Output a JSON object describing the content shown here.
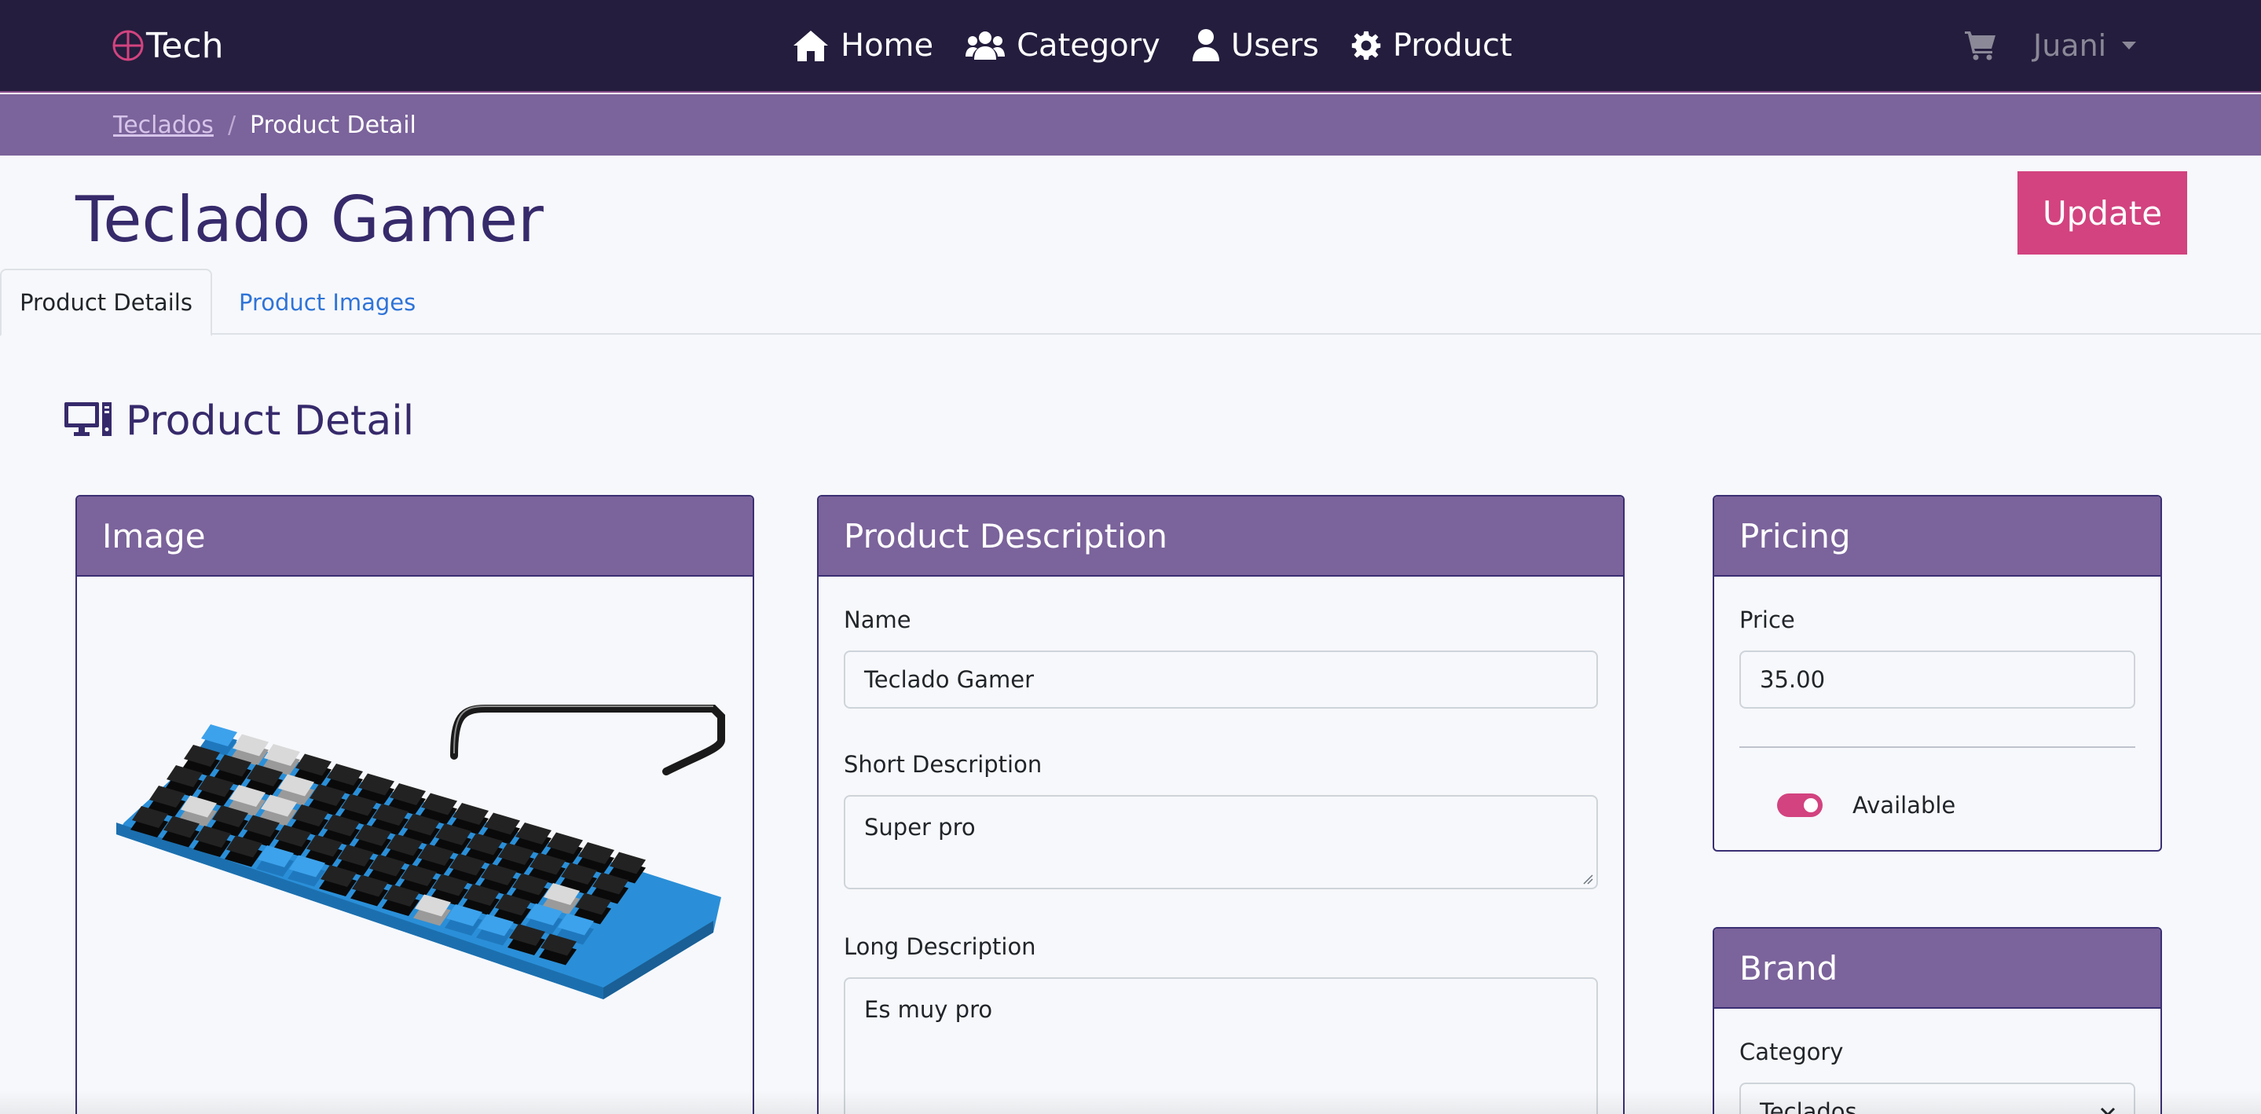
{
  "navbar": {
    "brand": "Tech",
    "links": [
      {
        "label": "Home",
        "icon": "home-icon"
      },
      {
        "label": "Category",
        "icon": "users-icon"
      },
      {
        "label": "Users",
        "icon": "user-icon"
      },
      {
        "label": "Product",
        "icon": "gear-icon"
      }
    ],
    "user": "Juani"
  },
  "breadcrumb": {
    "parent": "Teclados",
    "separator": "/",
    "current": "Product Detail"
  },
  "page": {
    "title": "Teclado Gamer",
    "update_label": "Update"
  },
  "tabs": {
    "details": "Product Details",
    "images": "Product Images"
  },
  "section": {
    "heading": "Product Detail"
  },
  "image_card": {
    "title": "Image"
  },
  "description_card": {
    "title": "Product Description",
    "name_label": "Name",
    "name_value": "Teclado Gamer",
    "short_label": "Short Description",
    "short_value": "Super pro",
    "long_label": "Long Description",
    "long_value": "Es muy pro"
  },
  "pricing_card": {
    "title": "Pricing",
    "price_label": "Price",
    "price_value": "35.00",
    "available_label": "Available",
    "available": true
  },
  "brand_card": {
    "title": "Brand",
    "category_label": "Category",
    "category_value": "Teclados"
  },
  "colors": {
    "navbar": "#241d3d",
    "accent_purple": "#7b639b",
    "primary_pink": "#d2437f",
    "title_text": "#372a6b"
  }
}
